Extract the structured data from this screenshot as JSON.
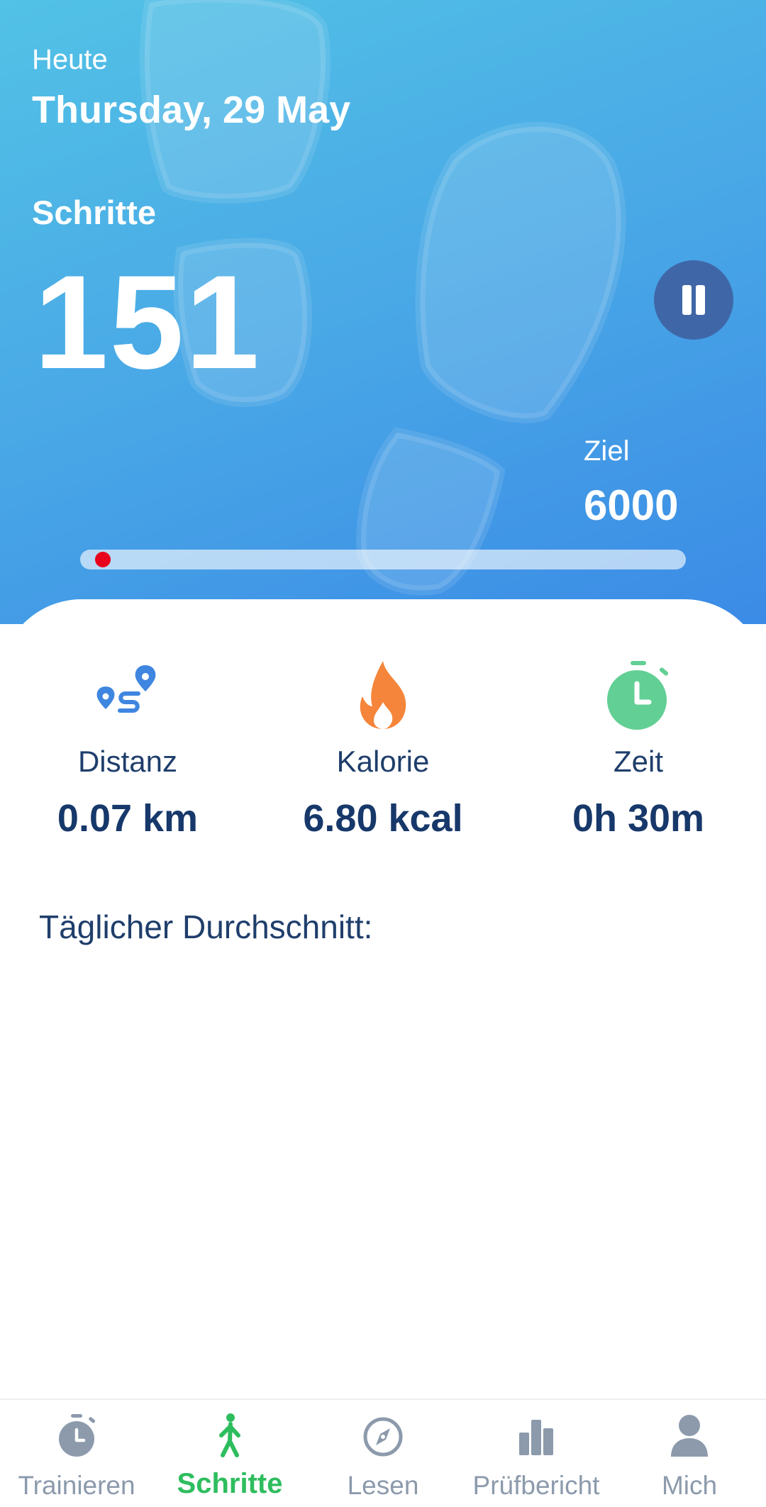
{
  "header": {
    "today_label": "Heute",
    "date": "Thursday, 29 May",
    "steps_label": "Schritte",
    "steps_value": "151",
    "goal_label": "Ziel",
    "goal_value": "6000",
    "progress_fraction": 0.025,
    "pause_icon": "pause-icon"
  },
  "stats": [
    {
      "icon": "route-icon",
      "label": "Distanz",
      "value": "0.07 km"
    },
    {
      "icon": "flame-icon",
      "label": "Kalorie",
      "value": "6.80 kcal"
    },
    {
      "icon": "stopwatch-icon",
      "label": "Zeit",
      "value": "0h 30m"
    }
  ],
  "daily_average_label": "Täglicher Durchschnitt:",
  "nav": {
    "items": [
      {
        "label": "Trainieren",
        "icon": "stopwatch-icon",
        "active": false
      },
      {
        "label": "Schritte",
        "icon": "walking-person-icon",
        "active": true
      },
      {
        "label": "Lesen",
        "icon": "compass-icon",
        "active": false
      },
      {
        "label": "Prüfbericht",
        "icon": "bar-chart-icon",
        "active": false
      },
      {
        "label": "Mich",
        "icon": "person-icon",
        "active": false
      }
    ]
  },
  "colors": {
    "header_gradient_start": "#52c2e6",
    "header_gradient_end": "#3b8be6",
    "pause_button": "#3f67a8",
    "progress_dot": "#e8001c",
    "text_dark_blue": "#17386a",
    "active_nav": "#2ebd5e",
    "inactive_nav": "#8c9aac",
    "distance_icon": "#3f86e0",
    "flame_icon": "#f5853a",
    "time_icon": "#62cf94"
  }
}
